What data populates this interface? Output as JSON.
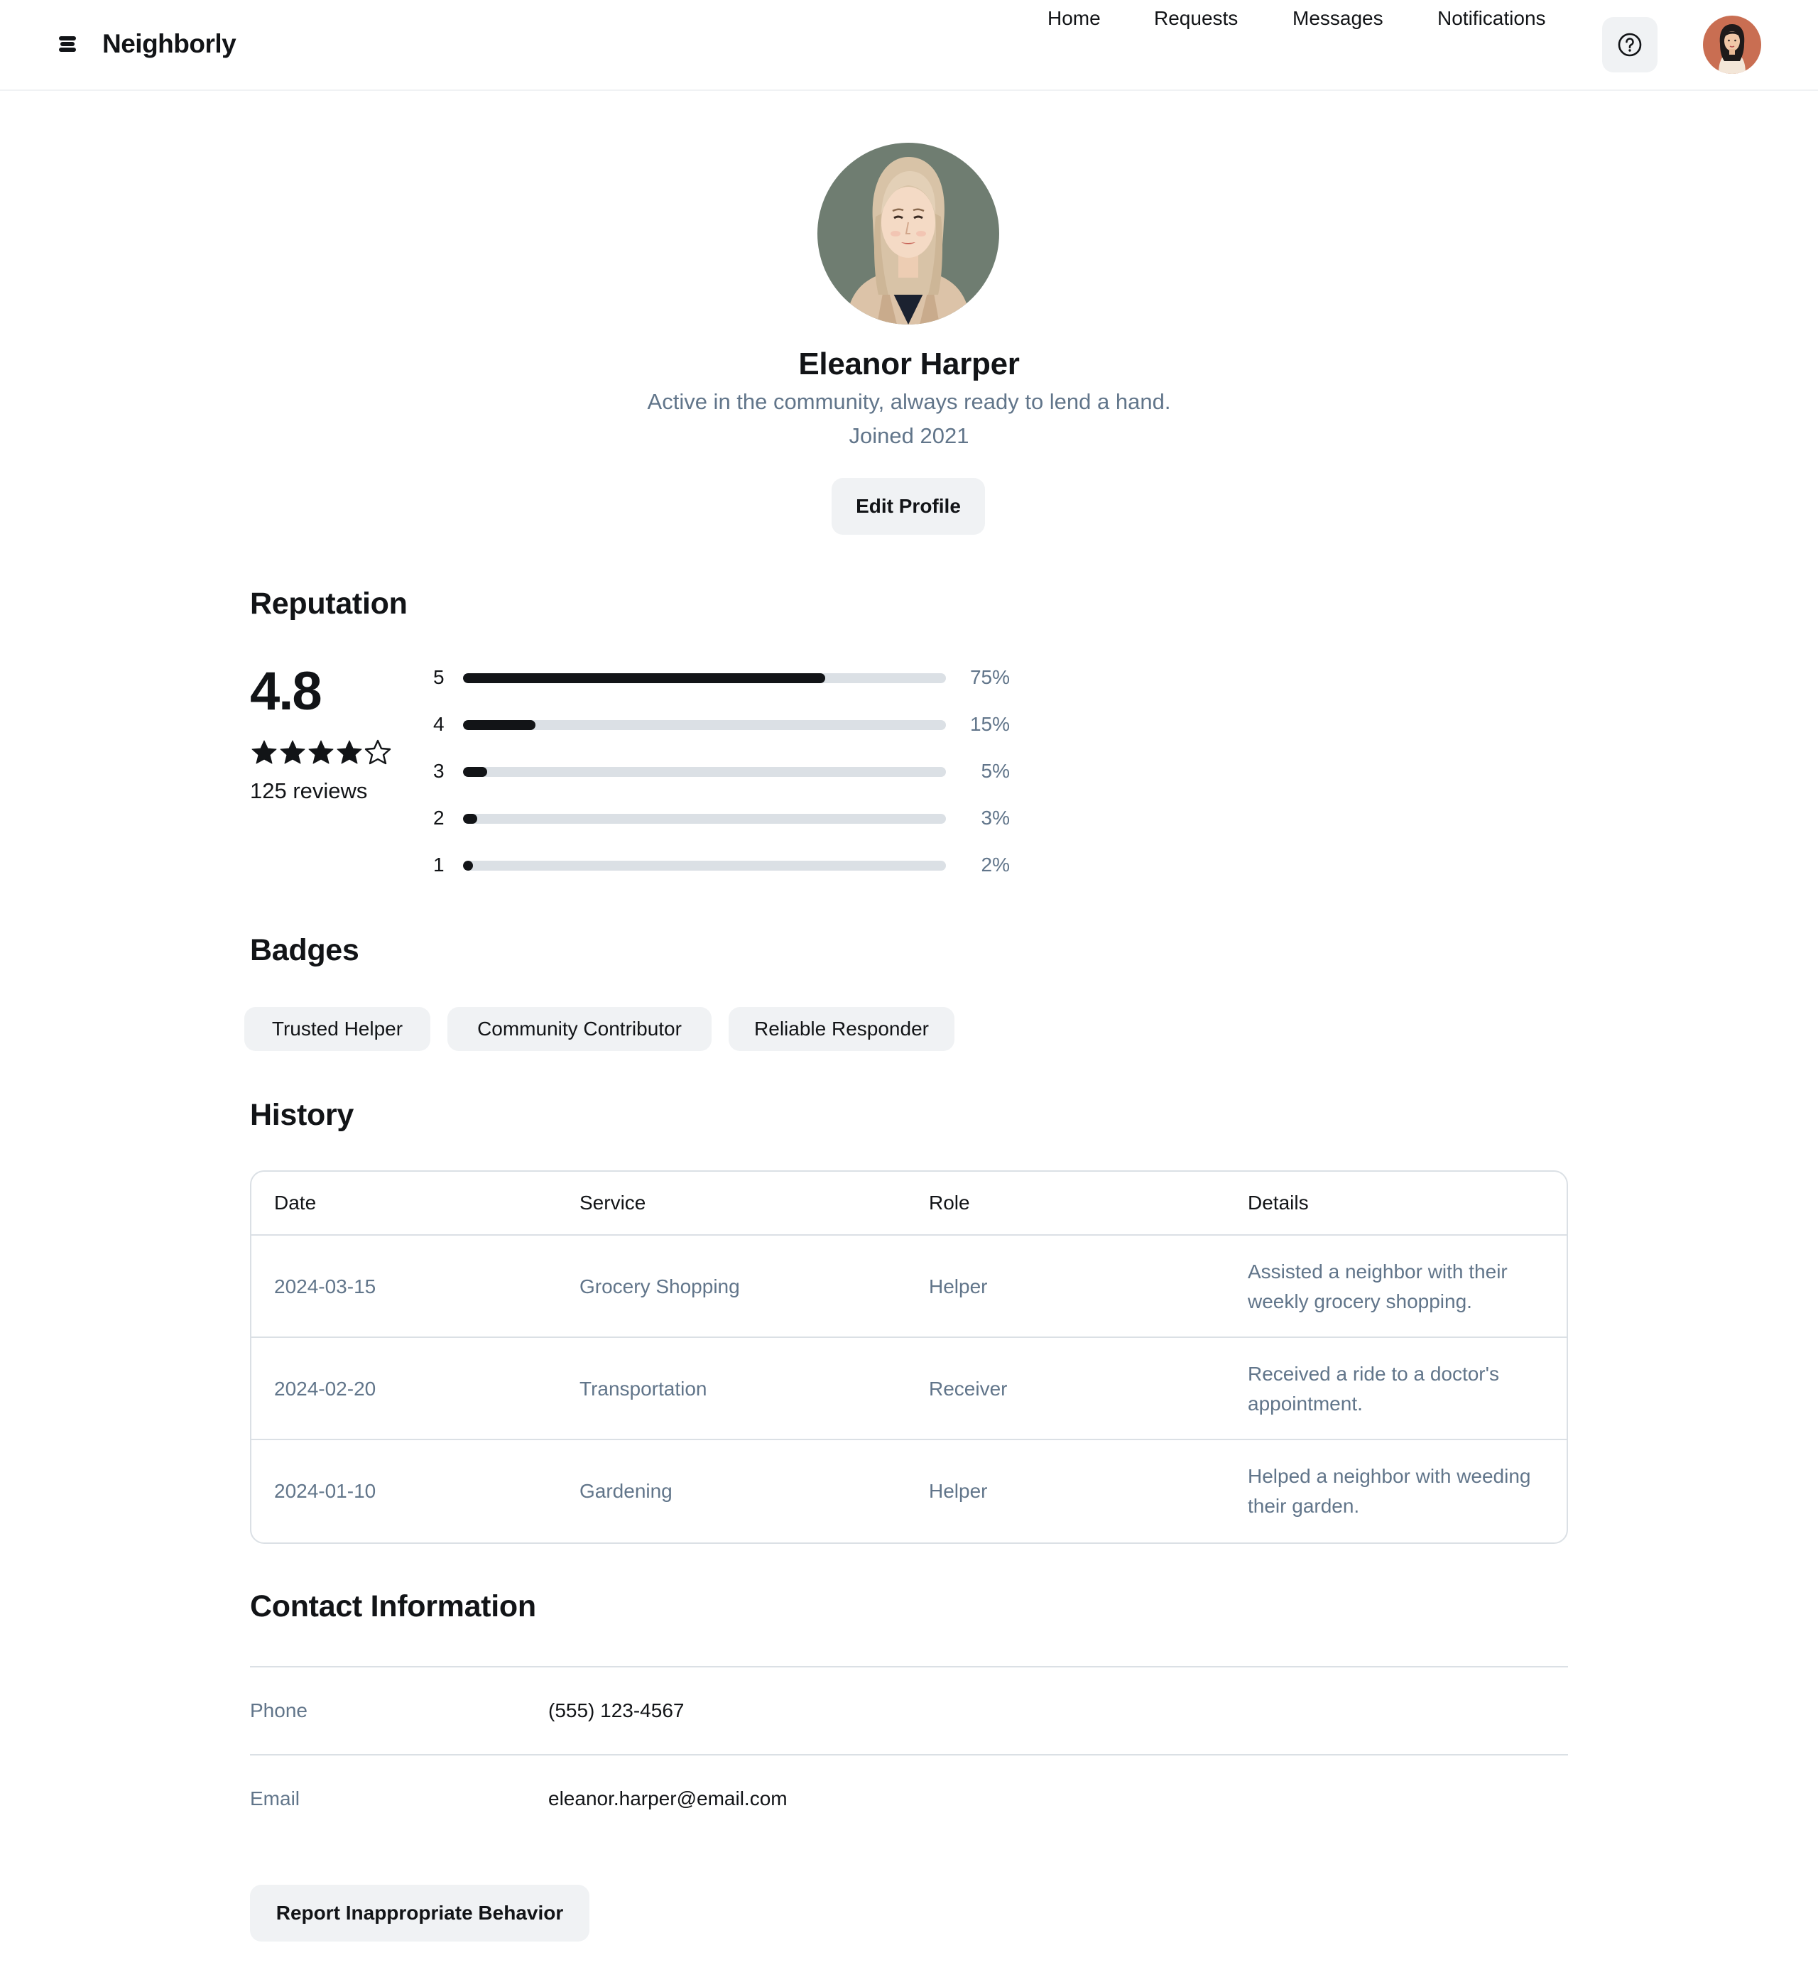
{
  "app": {
    "name": "Neighborly"
  },
  "nav": {
    "home": "Home",
    "requests": "Requests",
    "messages": "Messages",
    "notifications": "Notifications"
  },
  "icons": {
    "brand": "stack-logo-icon",
    "help": "help-circle-icon",
    "star_full": "star-filled-icon",
    "star_empty": "star-outline-icon"
  },
  "profile": {
    "name": "Eleanor Harper",
    "bio": "Active in the community, always ready to lend a hand.",
    "joined": "Joined 2021",
    "edit_label": "Edit Profile"
  },
  "reputation": {
    "title": "Reputation",
    "rating": "4.8",
    "stars_filled": 4,
    "stars_total": 5,
    "reviews": "125 reviews",
    "bars": [
      {
        "label": "5",
        "percent": "75%",
        "value": 75
      },
      {
        "label": "4",
        "percent": "15%",
        "value": 15
      },
      {
        "label": "3",
        "percent": "5%",
        "value": 5
      },
      {
        "label": "2",
        "percent": "3%",
        "value": 3
      },
      {
        "label": "1",
        "percent": "2%",
        "value": 2
      }
    ]
  },
  "badges": {
    "title": "Badges",
    "items": [
      "Trusted Helper",
      "Community Contributor",
      "Reliable Responder"
    ]
  },
  "history": {
    "title": "History",
    "columns": [
      "Date",
      "Service",
      "Role",
      "Details"
    ],
    "rows": [
      {
        "date": "2024-03-15",
        "service": "Grocery Shopping",
        "role": "Helper",
        "details": "Assisted a neighbor with their weekly grocery shopping."
      },
      {
        "date": "2024-02-20",
        "service": "Transportation",
        "role": "Receiver",
        "details": "Received a ride to a doctor's appointment."
      },
      {
        "date": "2024-01-10",
        "service": "Gardening",
        "role": "Helper",
        "details": "Helped a neighbor with weeding their garden."
      }
    ]
  },
  "contact": {
    "title": "Contact Information",
    "phone_label": "Phone",
    "phone": "(555) 123-4567",
    "email_label": "Email",
    "email": "eleanor.harper@email.com"
  },
  "report_label": "Report Inappropriate Behavior",
  "colors": {
    "text": "#121417",
    "muted": "#61758a",
    "surface": "#f0f2f4",
    "border": "#dbe0e5",
    "accent": "#121417"
  }
}
